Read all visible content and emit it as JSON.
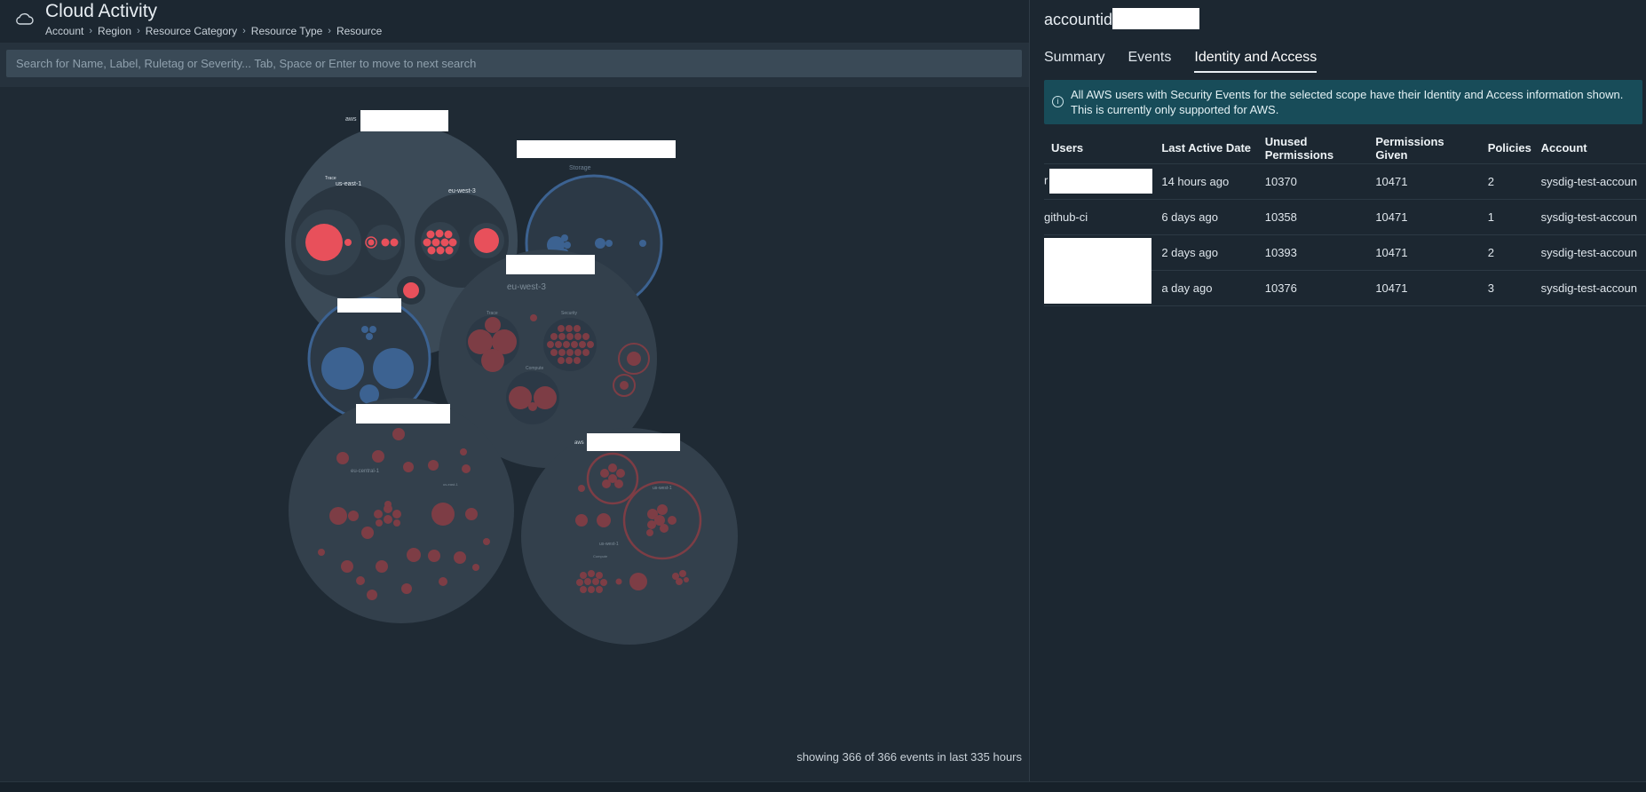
{
  "app": {
    "title": "Cloud Activity",
    "breadcrumbs": [
      "Account",
      "Region",
      "Resource Category",
      "Resource Type",
      "Resource"
    ],
    "icon": "cloud-icon"
  },
  "search": {
    "placeholder": "Search for Name, Label, Ruletag or Severity... Tab, Space or Enter to move to next search",
    "value": ""
  },
  "visualization": {
    "labels": {
      "aws": "aws",
      "region_us_east_1": "us-east-1",
      "region_eu_west_3_small": "eu-west-3",
      "trace": "Trace",
      "storage": "Storage",
      "region_eu_west_3_large": "eu-west-3",
      "trace2": "Trace",
      "security": "Security",
      "compute": "Compute",
      "region_eu_central_1": "eu-central-1",
      "region_eu_west_1": "eu-west-1",
      "region_us_east_1b": "us-east-1",
      "region_us_west_1": "us-west-1"
    },
    "colors": {
      "red": "#e8505b",
      "dim_red": "#7d3d45",
      "blue": "#3c6291",
      "dim_blue": "#2f4766"
    }
  },
  "footer": {
    "status": "showing 366 of 366 events in last 335 hours"
  },
  "panel": {
    "account_label": "accountid",
    "tabs": [
      {
        "label": "Summary",
        "active": false
      },
      {
        "label": "Events",
        "active": false
      },
      {
        "label": "Identity and Access",
        "active": true
      }
    ],
    "banner": {
      "line1": "All AWS users with Security Events for the selected scope have their Identity and Access information shown.",
      "line2": "This is currently only supported for AWS."
    },
    "table": {
      "headers": [
        "Users",
        "Last Active Date",
        "Unused Permissions",
        "Permissions Given",
        "Policies",
        "Account"
      ],
      "rows": [
        {
          "user": "r",
          "last_active": "14 hours ago",
          "unused": "10370",
          "given": "10471",
          "policies": "2",
          "account": "sysdig-test-accoun"
        },
        {
          "user": "github-ci",
          "last_active": "6 days ago",
          "unused": "10358",
          "given": "10471",
          "policies": "1",
          "account": "sysdig-test-accoun"
        },
        {
          "user": "",
          "last_active": "2 days ago",
          "unused": "10393",
          "given": "10471",
          "policies": "2",
          "account": "sysdig-test-accoun"
        },
        {
          "user": "",
          "last_active": "a day ago",
          "unused": "10376",
          "given": "10471",
          "policies": "3",
          "account": "sysdig-test-accoun"
        }
      ]
    }
  }
}
